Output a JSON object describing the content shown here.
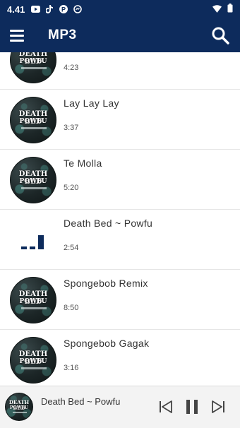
{
  "status_bar": {
    "time": "4.41",
    "icons": [
      "youtube-icon",
      "tiktok-icon",
      "pinterest-icon",
      "messenger-icon",
      "wifi-icon",
      "battery-icon"
    ]
  },
  "app_bar": {
    "title": "MP3",
    "background_color": "#0d2b5c"
  },
  "album_art": {
    "line1": "DEATH BED",
    "line2": "POWFU"
  },
  "songs": [
    {
      "title": "",
      "duration": "4:23",
      "art": "album",
      "partially_visible": true
    },
    {
      "title": "Lay Lay Lay",
      "duration": "3:37",
      "art": "album"
    },
    {
      "title": "Te Molla",
      "duration": "5:20",
      "art": "album"
    },
    {
      "title": "Death Bed ~ Powfu",
      "duration": "2:54",
      "art": "equalizer",
      "playing": true
    },
    {
      "title": "Spongebob Remix",
      "duration": "8:50",
      "art": "album"
    },
    {
      "title": "Spongebob Gagak",
      "duration": "3:16",
      "art": "album"
    }
  ],
  "now_playing": {
    "title": "Death Bed ~ Powfu",
    "state": "playing"
  }
}
